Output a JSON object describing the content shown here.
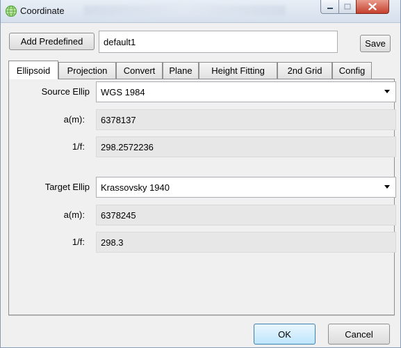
{
  "window": {
    "title": "Coordinate"
  },
  "toolbar": {
    "add_predefined_label": "Add Predefined",
    "name_value": "default1",
    "save_label": "Save"
  },
  "tabs": [
    {
      "label": "Ellipsoid",
      "active": true
    },
    {
      "label": "Projection",
      "active": false
    },
    {
      "label": "Convert",
      "active": false
    },
    {
      "label": "Plane",
      "active": false
    },
    {
      "label": "Height Fitting",
      "active": false
    },
    {
      "label": "2nd Grid",
      "active": false
    },
    {
      "label": "Config",
      "active": false
    }
  ],
  "ellipsoid": {
    "source": {
      "label": "Source Ellip",
      "value": "WGS 1984",
      "a_label": "a(m):",
      "a_value": "6378137",
      "f_label": "1/f:",
      "f_value": "298.2572236"
    },
    "target": {
      "label": "Target Ellip",
      "value": "Krassovsky 1940",
      "a_label": "a(m):",
      "a_value": "6378245",
      "f_label": "1/f:",
      "f_value": "298.3"
    }
  },
  "footer": {
    "ok_label": "OK",
    "cancel_label": "Cancel"
  },
  "colors": {
    "accent": "#3c7fb1",
    "close": "#c5402c",
    "icon": "#6fbf4a"
  }
}
